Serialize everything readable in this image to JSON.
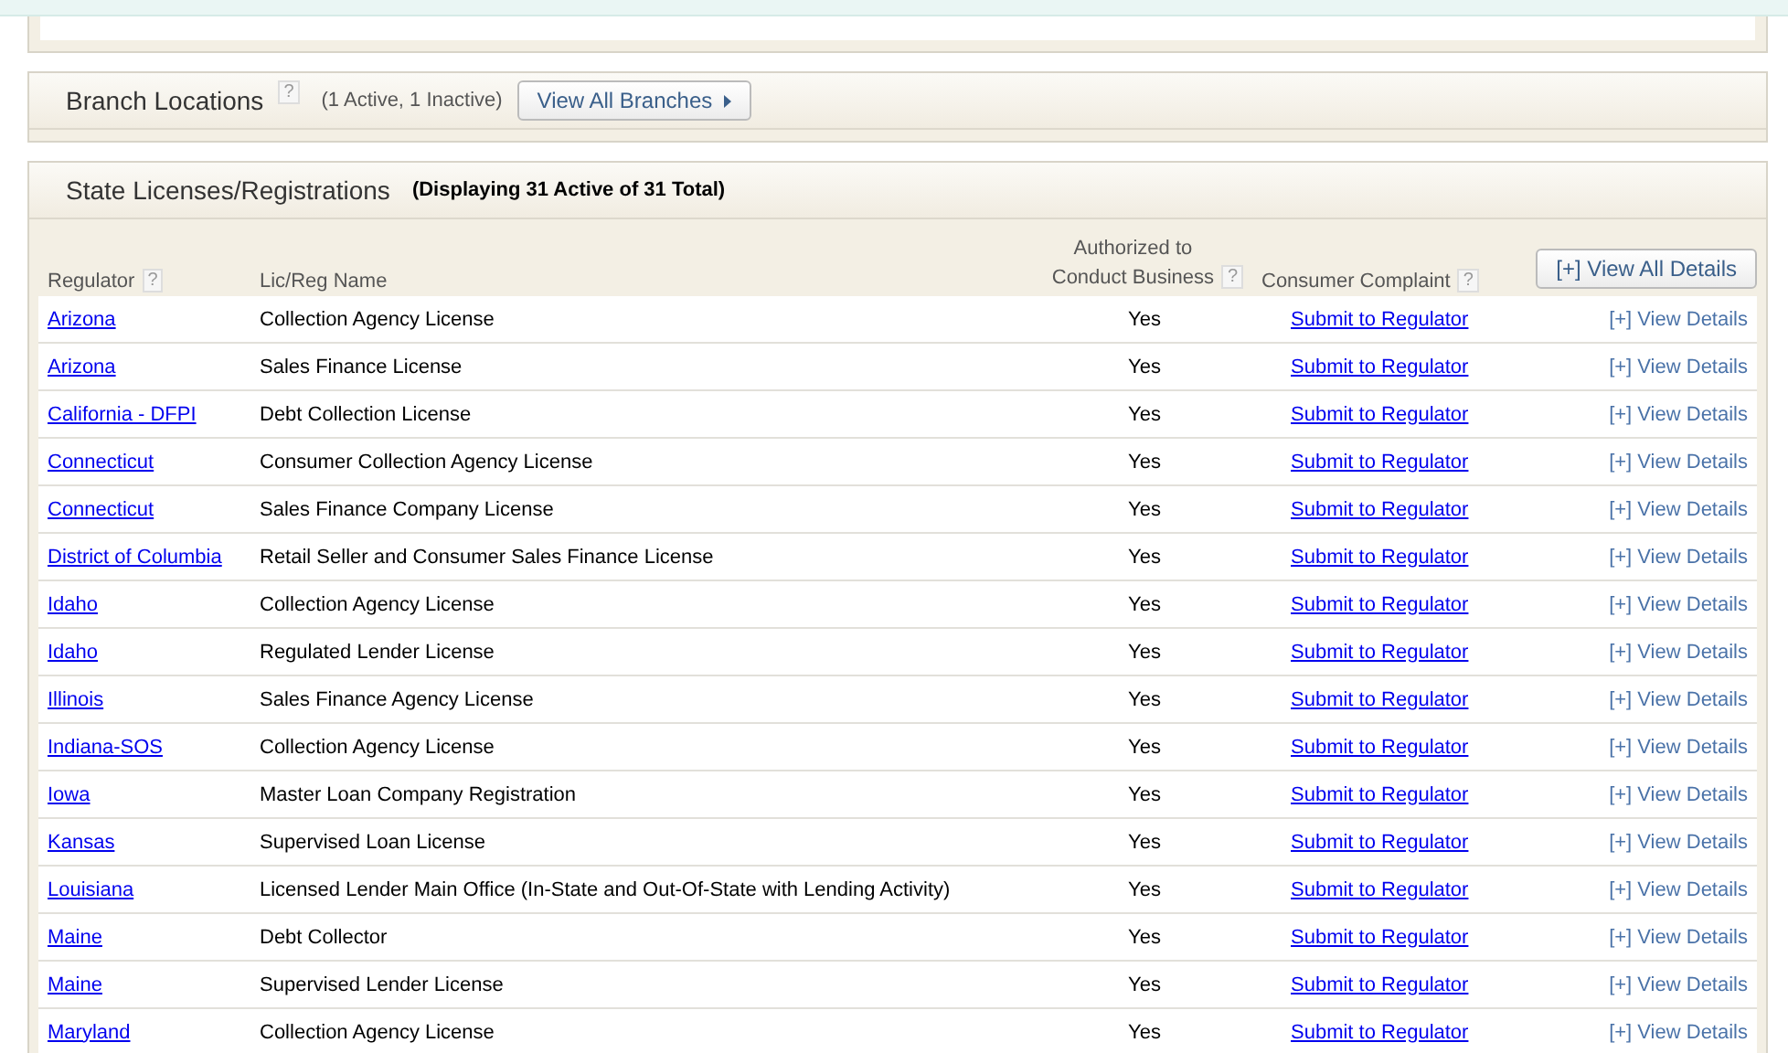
{
  "branch_locations": {
    "title": "Branch Locations",
    "help": "?",
    "summary": "(1 Active, 1 Inactive)",
    "button": "View All Branches"
  },
  "state_licenses": {
    "title": "State Licenses/Registrations",
    "summary": "(Displaying 31 Active of 31 Total)",
    "columns": [
      {
        "label": "Regulator",
        "help": "?"
      },
      {
        "label": "Lic/Reg Name"
      },
      {
        "label": "Authorized to Conduct Business",
        "help": "?"
      },
      {
        "label": "Consumer Complaint",
        "help": "?"
      }
    ],
    "view_all_button": "[+] View All Details",
    "rows": [
      {
        "regulator": "Arizona",
        "name": "Collection Agency License",
        "authorized": "Yes",
        "complaint": "Submit to Regulator",
        "details": "[+] View Details"
      },
      {
        "regulator": "Arizona",
        "name": "Sales Finance License",
        "authorized": "Yes",
        "complaint": "Submit to Regulator",
        "details": "[+] View Details"
      },
      {
        "regulator": "California - DFPI",
        "name": "Debt Collection License",
        "authorized": "Yes",
        "complaint": "Submit to Regulator",
        "details": "[+] View Details"
      },
      {
        "regulator": "Connecticut",
        "name": "Consumer Collection Agency License",
        "authorized": "Yes",
        "complaint": "Submit to Regulator",
        "details": "[+] View Details"
      },
      {
        "regulator": "Connecticut",
        "name": "Sales Finance Company License",
        "authorized": "Yes",
        "complaint": "Submit to Regulator",
        "details": "[+] View Details"
      },
      {
        "regulator": "District of Columbia",
        "name": "Retail Seller and Consumer Sales Finance License",
        "authorized": "Yes",
        "complaint": "Submit to Regulator",
        "details": "[+] View Details"
      },
      {
        "regulator": "Idaho",
        "name": "Collection Agency License",
        "authorized": "Yes",
        "complaint": "Submit to Regulator",
        "details": "[+] View Details"
      },
      {
        "regulator": "Idaho",
        "name": "Regulated Lender License",
        "authorized": "Yes",
        "complaint": "Submit to Regulator",
        "details": "[+] View Details"
      },
      {
        "regulator": "Illinois",
        "name": "Sales Finance Agency License",
        "authorized": "Yes",
        "complaint": "Submit to Regulator",
        "details": "[+] View Details"
      },
      {
        "regulator": "Indiana-SOS",
        "name": "Collection Agency License",
        "authorized": "Yes",
        "complaint": "Submit to Regulator",
        "details": "[+] View Details"
      },
      {
        "regulator": "Iowa",
        "name": "Master Loan Company Registration",
        "authorized": "Yes",
        "complaint": "Submit to Regulator",
        "details": "[+] View Details"
      },
      {
        "regulator": "Kansas",
        "name": "Supervised Loan License",
        "authorized": "Yes",
        "complaint": "Submit to Regulator",
        "details": "[+] View Details"
      },
      {
        "regulator": "Louisiana",
        "name": "Licensed Lender Main Office (In-State and Out-Of-State with Lending Activity)",
        "authorized": "Yes",
        "complaint": "Submit to Regulator",
        "details": "[+] View Details"
      },
      {
        "regulator": "Maine",
        "name": "Debt Collector",
        "authorized": "Yes",
        "complaint": "Submit to Regulator",
        "details": "[+] View Details"
      },
      {
        "regulator": "Maine",
        "name": "Supervised Lender License",
        "authorized": "Yes",
        "complaint": "Submit to Regulator",
        "details": "[+] View Details"
      },
      {
        "regulator": "Maryland",
        "name": "Collection Agency License",
        "authorized": "Yes",
        "complaint": "Submit to Regulator",
        "details": "[+] View Details"
      }
    ]
  }
}
